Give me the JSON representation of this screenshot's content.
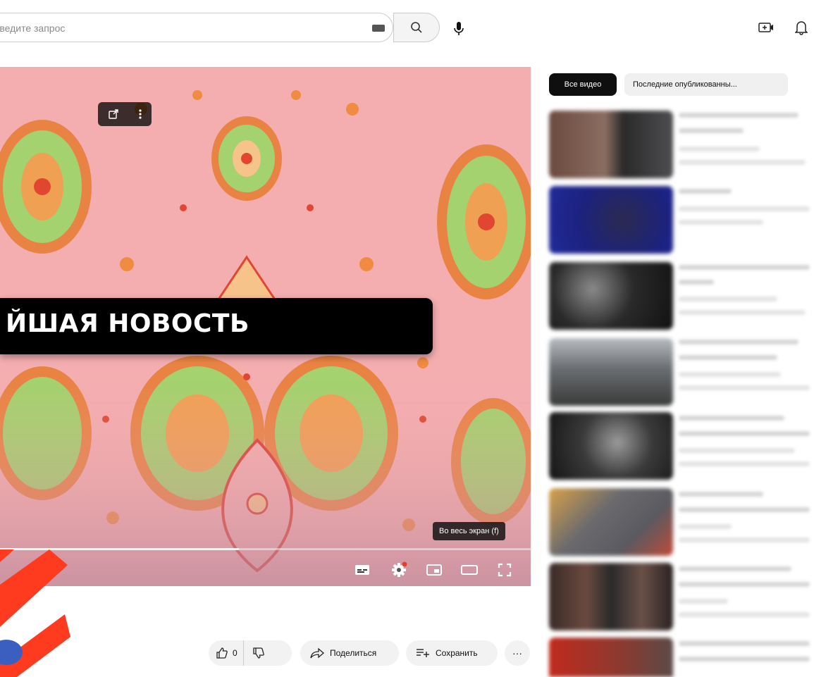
{
  "search": {
    "placeholder": "Введите запрос"
  },
  "player": {
    "banner_text": "ЙШАЯ НОВОСТЬ",
    "fullscreen_tooltip": "Во весь экран (f)",
    "progress": 0.45
  },
  "actions": {
    "like_count": "0",
    "share_label": "Поделиться",
    "save_label": "Сохранить",
    "more_label": "···"
  },
  "filters": {
    "all_label": "Все видео",
    "recent_label": "Последние опубликованны..."
  },
  "colors": {
    "chip_active_bg": "#0f0f0f",
    "banner_bg": "#000000",
    "accent_stripes": "#ff3b1f"
  },
  "icons": {
    "search": "search-icon",
    "mic": "mic-icon",
    "keyboard": "keyboard-icon",
    "create": "create-video-icon",
    "notifications": "bell-icon"
  }
}
